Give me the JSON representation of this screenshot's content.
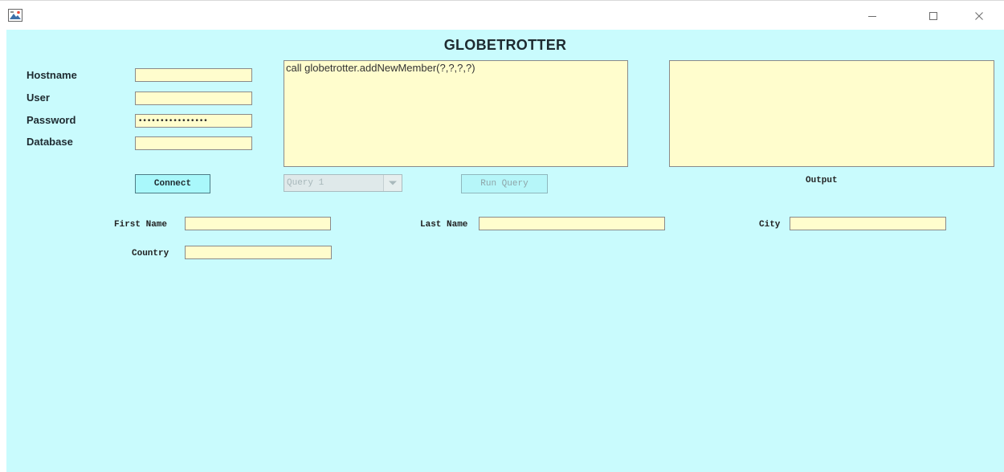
{
  "window": {
    "title": "",
    "min_glyph": "—",
    "max_glyph": "☐",
    "close_glyph": "✕"
  },
  "app": {
    "title": "GLOBETROTTER"
  },
  "connection": {
    "hostname_label": "Hostname",
    "user_label": "User",
    "password_label": "Password",
    "database_label": "Database",
    "hostname_value": "",
    "user_value": "",
    "password_value": "••••••••••••••••",
    "database_value": "",
    "connect_label": "Connect"
  },
  "query": {
    "text": "call globetrotter.addNewMember(?,?,?,?)",
    "selected": "Query 1",
    "run_label": "Run Query"
  },
  "output": {
    "label": "Output",
    "text": ""
  },
  "form": {
    "first_name_label": "First Name",
    "last_name_label": "Last Name",
    "city_label": "City",
    "country_label": "Country",
    "first_name_value": "",
    "last_name_value": "",
    "city_value": "",
    "country_value": ""
  },
  "colors": {
    "background": "#c9fbfd",
    "field": "#fffdcd",
    "button": "#a9f8fb"
  },
  "icons": {
    "app": "java-app-icon",
    "combo_arrow": "chevron-down-icon"
  }
}
